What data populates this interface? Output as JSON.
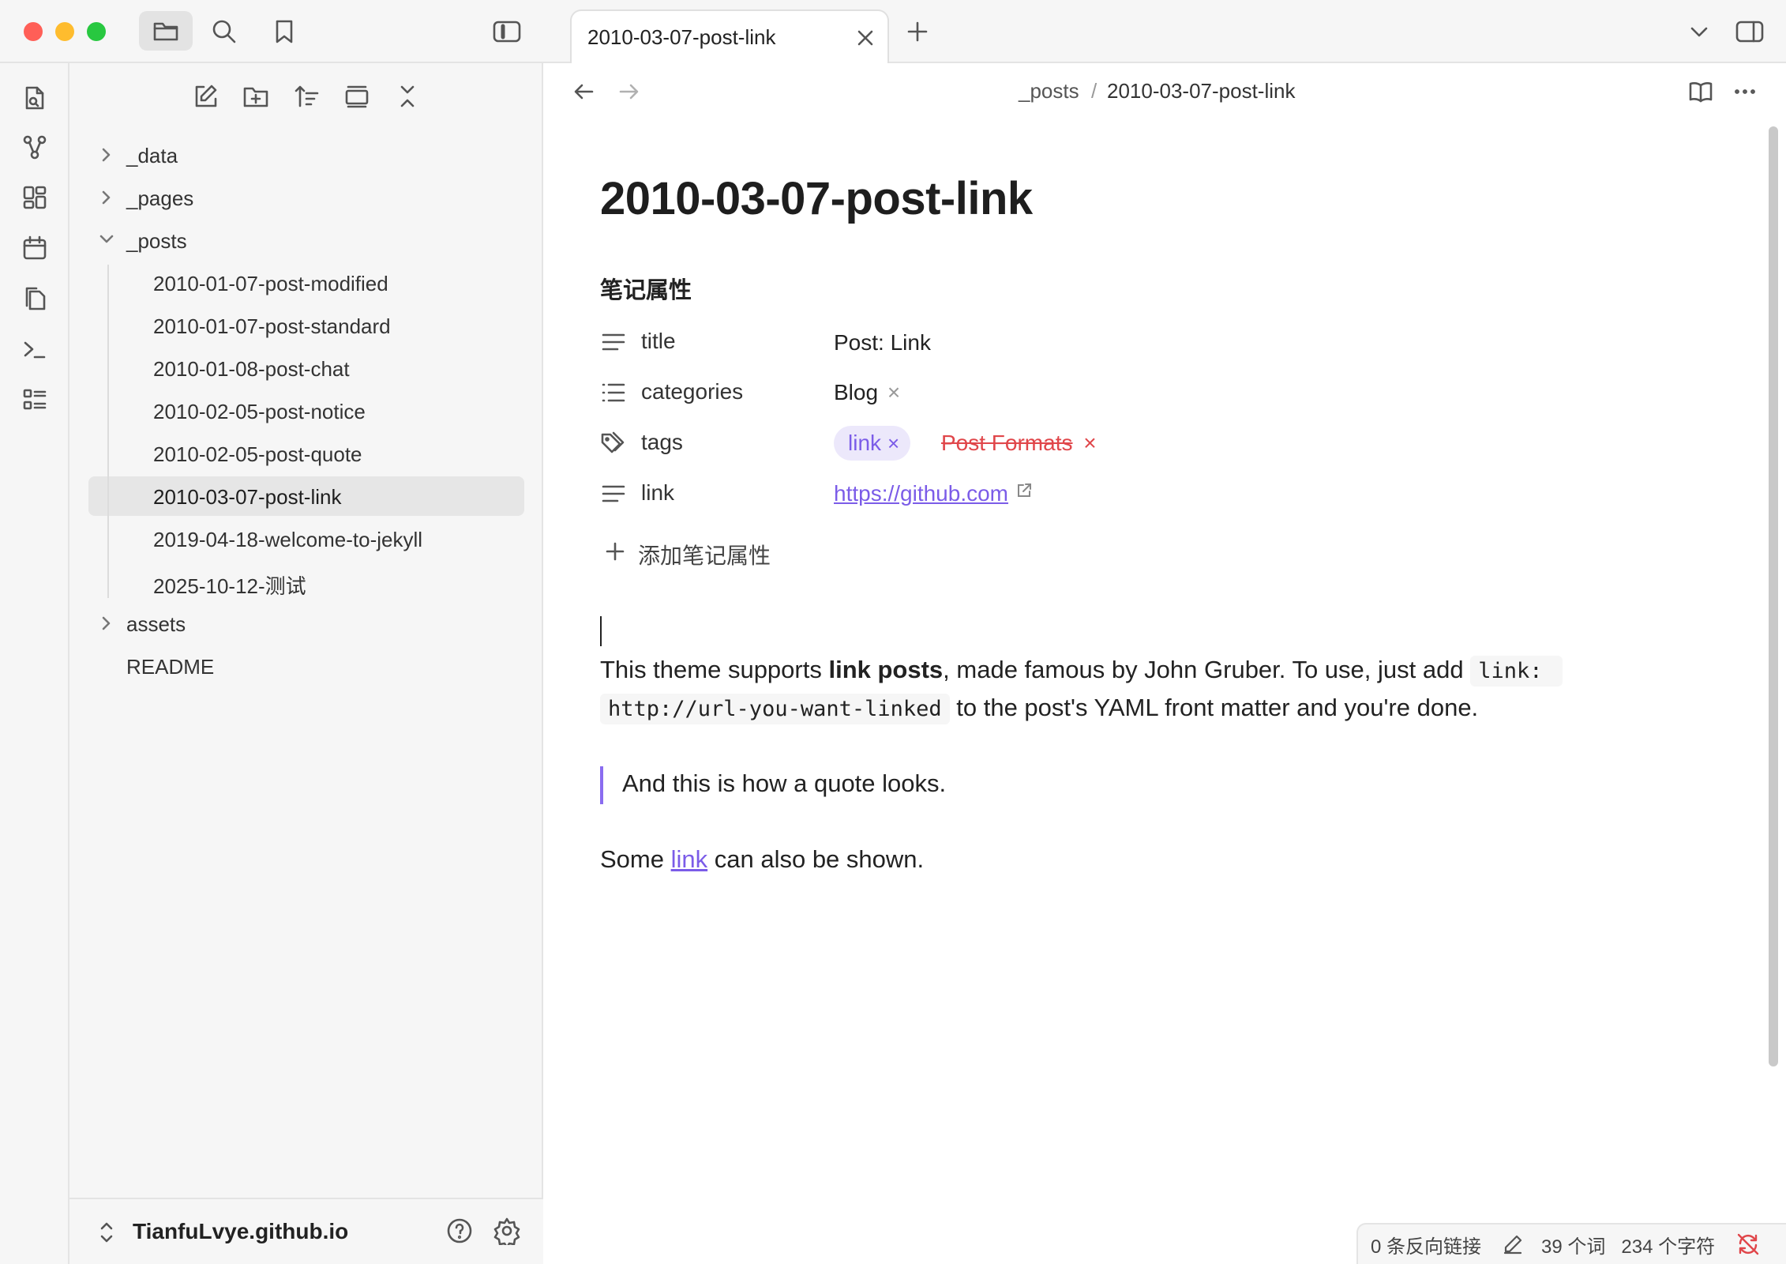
{
  "window": {
    "traffic_colors": [
      "#ff5f57",
      "#febc2e",
      "#28c840"
    ]
  },
  "tab": {
    "title": "2010-03-07-post-link"
  },
  "breadcrumb": {
    "folder": "_posts",
    "separator": "/",
    "file": "2010-03-07-post-link"
  },
  "sidebar": {
    "tree": [
      {
        "label": "_data",
        "type": "folder",
        "expanded": false
      },
      {
        "label": "_pages",
        "type": "folder",
        "expanded": false
      },
      {
        "label": "_posts",
        "type": "folder",
        "expanded": true
      },
      {
        "label": "2010-01-07-post-modified",
        "type": "file"
      },
      {
        "label": "2010-01-07-post-standard",
        "type": "file"
      },
      {
        "label": "2010-01-08-post-chat",
        "type": "file"
      },
      {
        "label": "2010-02-05-post-notice",
        "type": "file"
      },
      {
        "label": "2010-02-05-post-quote",
        "type": "file"
      },
      {
        "label": "2010-03-07-post-link",
        "type": "file",
        "active": true
      },
      {
        "label": "2019-04-18-welcome-to-jekyll",
        "type": "file"
      },
      {
        "label": "2025-10-12-测试",
        "type": "file"
      },
      {
        "label": "assets",
        "type": "folder",
        "expanded": false
      },
      {
        "label": "README",
        "type": "file"
      }
    ],
    "vault_name": "TianfuLvye.github.io"
  },
  "note": {
    "title": "2010-03-07-post-link",
    "properties_heading": "笔记属性",
    "properties": {
      "title": {
        "key": "title",
        "value": "Post: Link"
      },
      "categories": {
        "key": "categories",
        "value": "Blog",
        "remove": "×"
      },
      "tags": {
        "key": "tags",
        "items": [
          {
            "label": "link",
            "remove": "×"
          },
          {
            "label": "Post Formats",
            "remove": "×"
          }
        ]
      },
      "link": {
        "key": "link",
        "value": "https://github.com"
      }
    },
    "add_property": "添加笔记属性",
    "paragraph1": {
      "before": "This theme supports ",
      "bold": "link posts",
      "after": ", made famous by John Gruber. To use, just add ",
      "code1": "link:",
      "code2": "http://url-you-want-linked",
      "tail": " to the post's YAML front matter and you're done."
    },
    "quote": "And this is how a quote looks.",
    "paragraph2": {
      "before": "Some ",
      "link": "link",
      "after": " can also be shown."
    }
  },
  "status_bar": {
    "backlinks": "0 条反向链接",
    "words": "39 个词",
    "chars": "234 个字符"
  },
  "colors": {
    "accent": "#7b5ce8",
    "error_tag": "#e0464a",
    "sync_error": "#e0464a"
  }
}
